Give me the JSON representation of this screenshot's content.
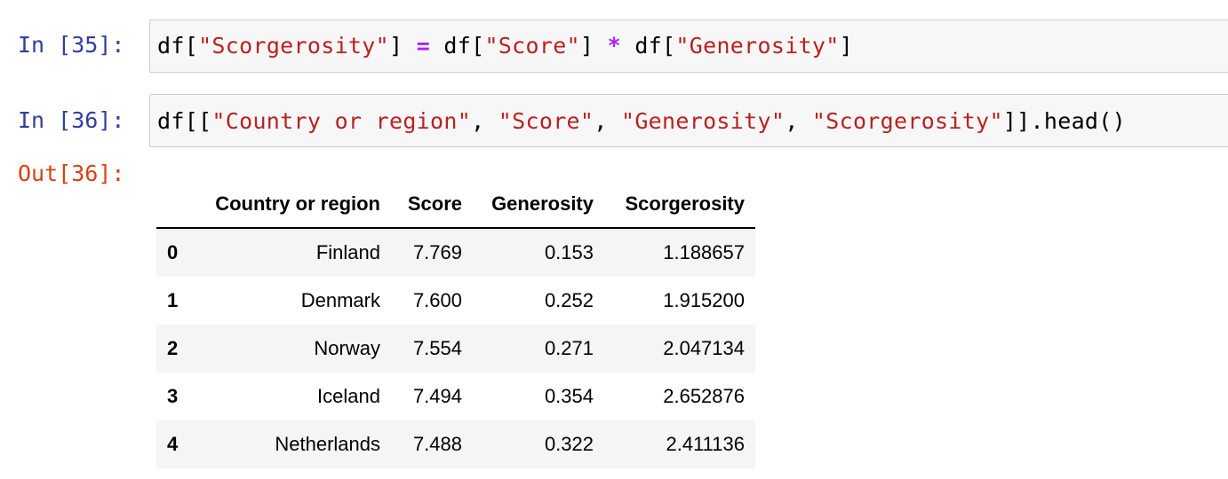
{
  "cells": [
    {
      "prompt": "In [35]:",
      "code_tokens": [
        {
          "t": "df[",
          "k": "punc"
        },
        {
          "t": "\"Scorgerosity\"",
          "k": "str"
        },
        {
          "t": "] ",
          "k": "punc"
        },
        {
          "t": "=",
          "k": "op"
        },
        {
          "t": " df[",
          "k": "punc"
        },
        {
          "t": "\"Score\"",
          "k": "str"
        },
        {
          "t": "] ",
          "k": "punc"
        },
        {
          "t": "*",
          "k": "op"
        },
        {
          "t": " df[",
          "k": "punc"
        },
        {
          "t": "\"Generosity\"",
          "k": "str"
        },
        {
          "t": "]",
          "k": "punc"
        }
      ]
    },
    {
      "prompt": "In [36]:",
      "code_tokens": [
        {
          "t": "df[[",
          "k": "punc"
        },
        {
          "t": "\"Country or region\"",
          "k": "str"
        },
        {
          "t": ", ",
          "k": "punc"
        },
        {
          "t": "\"Score\"",
          "k": "str"
        },
        {
          "t": ", ",
          "k": "punc"
        },
        {
          "t": "\"Generosity\"",
          "k": "str"
        },
        {
          "t": ", ",
          "k": "punc"
        },
        {
          "t": "\"Scorgerosity\"",
          "k": "str"
        },
        {
          "t": "]].head()",
          "k": "punc"
        }
      ]
    }
  ],
  "output": {
    "prompt": "Out[36]:",
    "columns": [
      "",
      "Country or region",
      "Score",
      "Generosity",
      "Scorgerosity"
    ],
    "rows": [
      {
        "index": "0",
        "values": [
          "Finland",
          "7.769",
          "0.153",
          "1.188657"
        ]
      },
      {
        "index": "1",
        "values": [
          "Denmark",
          "7.600",
          "0.252",
          "1.915200"
        ]
      },
      {
        "index": "2",
        "values": [
          "Norway",
          "7.554",
          "0.271",
          "2.047134"
        ]
      },
      {
        "index": "3",
        "values": [
          "Iceland",
          "7.494",
          "0.354",
          "2.652876"
        ]
      },
      {
        "index": "4",
        "values": [
          "Netherlands",
          "7.488",
          "0.322",
          "2.411136"
        ]
      }
    ]
  },
  "colors": {
    "in_prompt": "#303f9f",
    "out_prompt": "#d84315",
    "string": "#ba2121",
    "operator": "#aa22ff"
  }
}
